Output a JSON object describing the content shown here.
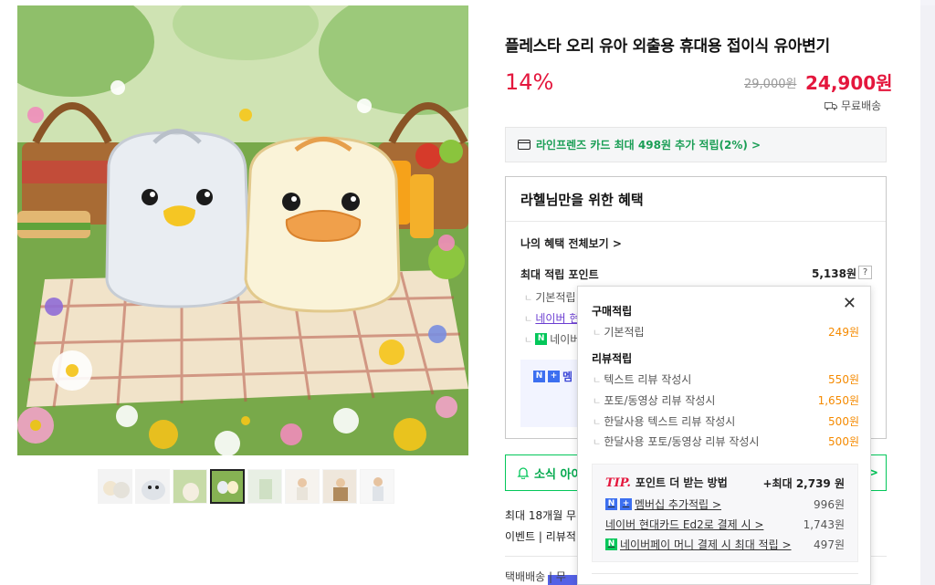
{
  "product": {
    "title": "플레스타 오리 유아 외출용 휴대용 접이식 유아변기",
    "discount": "14%",
    "original_price": "29,000원",
    "price": "24,900원",
    "shipping": "무료배송"
  },
  "card_benefit": {
    "text": "라인프렌즈 카드 최대 498원 추가 적립(2%) >"
  },
  "benefit": {
    "title": "라헬님만을 위한 혜택",
    "my_benefit_link": "나의 혜택 전체보기 >",
    "max_point_label": "최대 적립 포인트",
    "max_point_value": "5,138원",
    "help": "?",
    "sub_rows": [
      "기본적립",
      "네이버 현",
      "네이버"
    ],
    "member_label": "멤"
  },
  "notice": {
    "label": "소식 아이",
    "arrow": ">"
  },
  "info": {
    "installment": "최대 18개월 무",
    "event": "이벤트 | 리뷰적",
    "shipping": "택배배송 | 무"
  },
  "popup": {
    "close": "✕",
    "purchase_title": "구매적립",
    "purchase_rows": [
      {
        "k": "기본적립",
        "v": "249원"
      }
    ],
    "review_title": "리뷰적립",
    "review_rows": [
      {
        "k": "텍스트 리뷰 작성시",
        "v": "550원"
      },
      {
        "k": "포토/동영상 리뷰 작성시",
        "v": "1,650원"
      },
      {
        "k": "한달사용 텍스트 리뷰 작성시",
        "v": "500원"
      },
      {
        "k": "한달사용 포토/동영상 리뷰 작성시",
        "v": "500원"
      }
    ],
    "tip": {
      "tip_label": "TIP.",
      "title": "포인트 더 받는 방법",
      "total": "+최대 2,739 원",
      "rows": [
        {
          "k": "멤버십 추가적립 >",
          "v": "996원"
        },
        {
          "k": "네이버 현대카드 Ed2로 결제 시 >",
          "v": "1,743원"
        },
        {
          "k": "네이버페이 머니 결제 시 최대 적립 >",
          "v": "497원"
        }
      ]
    }
  },
  "colors": {
    "accent_red": "#e4173d",
    "naver_green": "#03c75a",
    "orange": "#f58a00"
  },
  "thumbnails_count": 8
}
